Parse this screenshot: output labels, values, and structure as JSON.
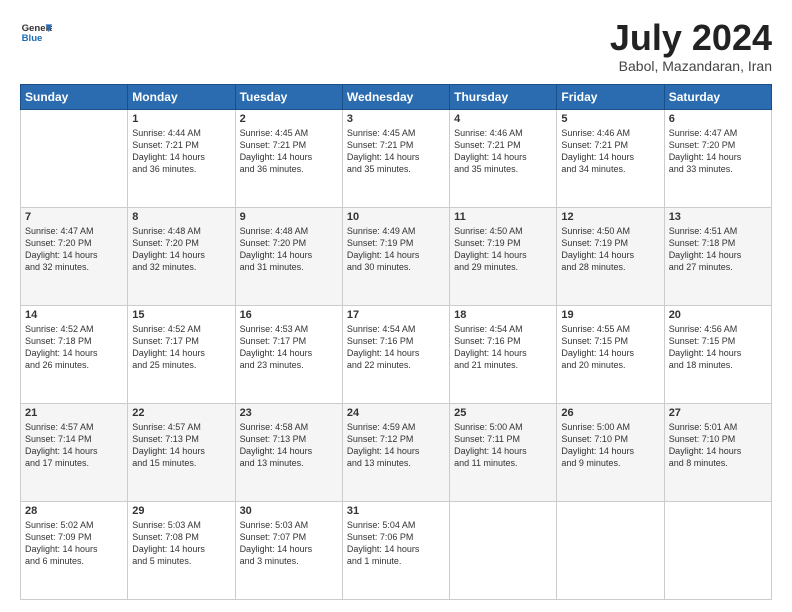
{
  "header": {
    "logo_general": "General",
    "logo_blue": "Blue",
    "title": "July 2024",
    "location": "Babol, Mazandaran, Iran"
  },
  "days": [
    "Sunday",
    "Monday",
    "Tuesday",
    "Wednesday",
    "Thursday",
    "Friday",
    "Saturday"
  ],
  "weeks": [
    [
      {
        "day": "",
        "data": ""
      },
      {
        "day": "1",
        "data": "Sunrise: 4:44 AM\nSunset: 7:21 PM\nDaylight: 14 hours\nand 36 minutes."
      },
      {
        "day": "2",
        "data": "Sunrise: 4:45 AM\nSunset: 7:21 PM\nDaylight: 14 hours\nand 36 minutes."
      },
      {
        "day": "3",
        "data": "Sunrise: 4:45 AM\nSunset: 7:21 PM\nDaylight: 14 hours\nand 35 minutes."
      },
      {
        "day": "4",
        "data": "Sunrise: 4:46 AM\nSunset: 7:21 PM\nDaylight: 14 hours\nand 35 minutes."
      },
      {
        "day": "5",
        "data": "Sunrise: 4:46 AM\nSunset: 7:21 PM\nDaylight: 14 hours\nand 34 minutes."
      },
      {
        "day": "6",
        "data": "Sunrise: 4:47 AM\nSunset: 7:20 PM\nDaylight: 14 hours\nand 33 minutes."
      }
    ],
    [
      {
        "day": "7",
        "data": "Sunrise: 4:47 AM\nSunset: 7:20 PM\nDaylight: 14 hours\nand 32 minutes."
      },
      {
        "day": "8",
        "data": "Sunrise: 4:48 AM\nSunset: 7:20 PM\nDaylight: 14 hours\nand 32 minutes."
      },
      {
        "day": "9",
        "data": "Sunrise: 4:48 AM\nSunset: 7:20 PM\nDaylight: 14 hours\nand 31 minutes."
      },
      {
        "day": "10",
        "data": "Sunrise: 4:49 AM\nSunset: 7:19 PM\nDaylight: 14 hours\nand 30 minutes."
      },
      {
        "day": "11",
        "data": "Sunrise: 4:50 AM\nSunset: 7:19 PM\nDaylight: 14 hours\nand 29 minutes."
      },
      {
        "day": "12",
        "data": "Sunrise: 4:50 AM\nSunset: 7:19 PM\nDaylight: 14 hours\nand 28 minutes."
      },
      {
        "day": "13",
        "data": "Sunrise: 4:51 AM\nSunset: 7:18 PM\nDaylight: 14 hours\nand 27 minutes."
      }
    ],
    [
      {
        "day": "14",
        "data": "Sunrise: 4:52 AM\nSunset: 7:18 PM\nDaylight: 14 hours\nand 26 minutes."
      },
      {
        "day": "15",
        "data": "Sunrise: 4:52 AM\nSunset: 7:17 PM\nDaylight: 14 hours\nand 25 minutes."
      },
      {
        "day": "16",
        "data": "Sunrise: 4:53 AM\nSunset: 7:17 PM\nDaylight: 14 hours\nand 23 minutes."
      },
      {
        "day": "17",
        "data": "Sunrise: 4:54 AM\nSunset: 7:16 PM\nDaylight: 14 hours\nand 22 minutes."
      },
      {
        "day": "18",
        "data": "Sunrise: 4:54 AM\nSunset: 7:16 PM\nDaylight: 14 hours\nand 21 minutes."
      },
      {
        "day": "19",
        "data": "Sunrise: 4:55 AM\nSunset: 7:15 PM\nDaylight: 14 hours\nand 20 minutes."
      },
      {
        "day": "20",
        "data": "Sunrise: 4:56 AM\nSunset: 7:15 PM\nDaylight: 14 hours\nand 18 minutes."
      }
    ],
    [
      {
        "day": "21",
        "data": "Sunrise: 4:57 AM\nSunset: 7:14 PM\nDaylight: 14 hours\nand 17 minutes."
      },
      {
        "day": "22",
        "data": "Sunrise: 4:57 AM\nSunset: 7:13 PM\nDaylight: 14 hours\nand 15 minutes."
      },
      {
        "day": "23",
        "data": "Sunrise: 4:58 AM\nSunset: 7:13 PM\nDaylight: 14 hours\nand 13 minutes."
      },
      {
        "day": "24",
        "data": "Sunrise: 4:59 AM\nSunset: 7:12 PM\nDaylight: 14 hours\nand 13 minutes."
      },
      {
        "day": "25",
        "data": "Sunrise: 5:00 AM\nSunset: 7:11 PM\nDaylight: 14 hours\nand 11 minutes."
      },
      {
        "day": "26",
        "data": "Sunrise: 5:00 AM\nSunset: 7:10 PM\nDaylight: 14 hours\nand 9 minutes."
      },
      {
        "day": "27",
        "data": "Sunrise: 5:01 AM\nSunset: 7:10 PM\nDaylight: 14 hours\nand 8 minutes."
      }
    ],
    [
      {
        "day": "28",
        "data": "Sunrise: 5:02 AM\nSunset: 7:09 PM\nDaylight: 14 hours\nand 6 minutes."
      },
      {
        "day": "29",
        "data": "Sunrise: 5:03 AM\nSunset: 7:08 PM\nDaylight: 14 hours\nand 5 minutes."
      },
      {
        "day": "30",
        "data": "Sunrise: 5:03 AM\nSunset: 7:07 PM\nDaylight: 14 hours\nand 3 minutes."
      },
      {
        "day": "31",
        "data": "Sunrise: 5:04 AM\nSunset: 7:06 PM\nDaylight: 14 hours\nand 1 minute."
      },
      {
        "day": "",
        "data": ""
      },
      {
        "day": "",
        "data": ""
      },
      {
        "day": "",
        "data": ""
      }
    ]
  ]
}
